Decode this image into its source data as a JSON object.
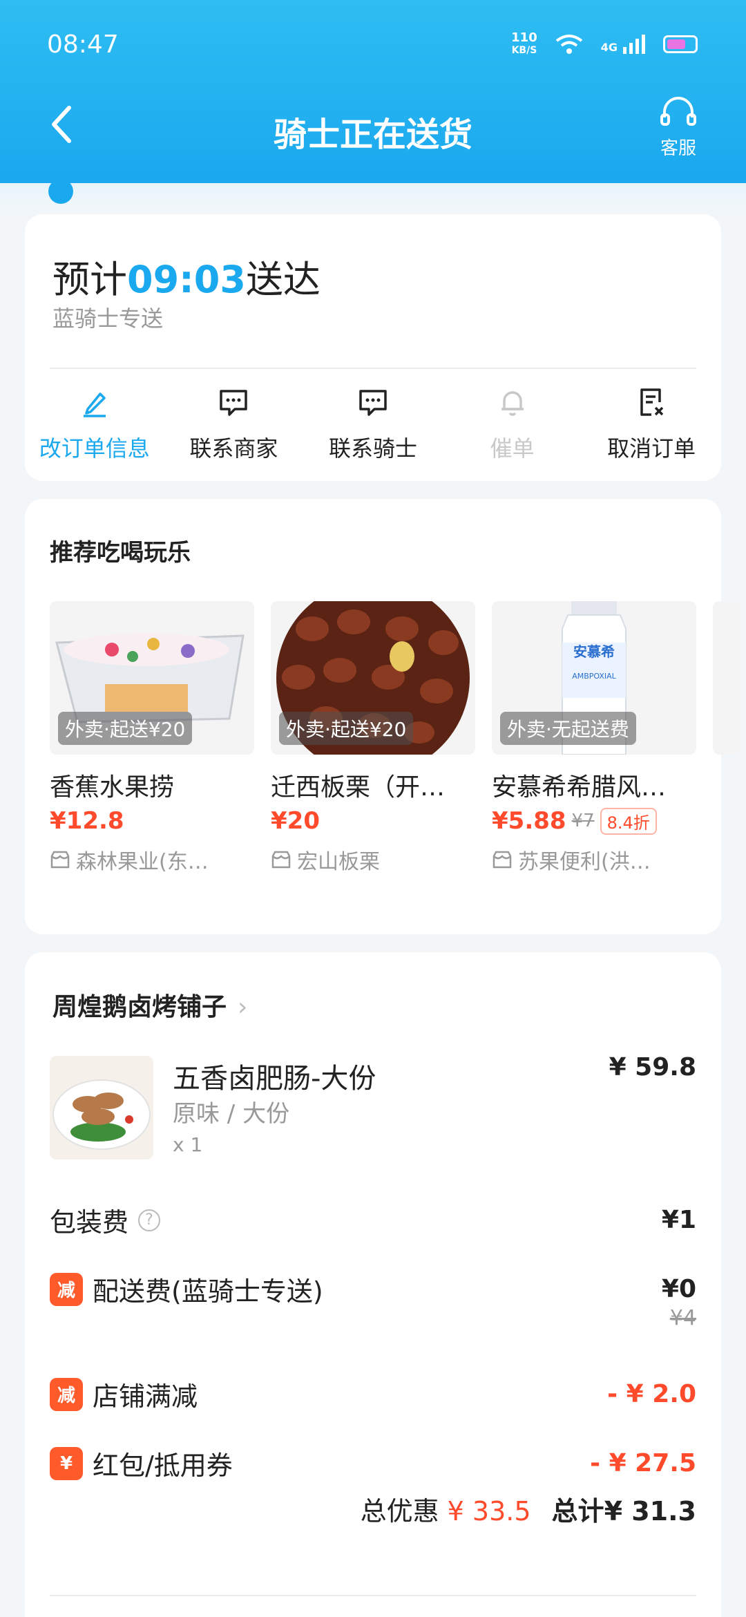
{
  "status_bar": {
    "time": "08:47",
    "speed_value": "110",
    "speed_unit": "KB/S",
    "network": "4G",
    "battery": "8"
  },
  "header": {
    "title": "骑士正在送货",
    "customer_service": "客服"
  },
  "delivery": {
    "eta_prefix": "预计",
    "eta_time": "09:03",
    "eta_suffix": "送达",
    "rider_type": "蓝骑士专送",
    "actions": [
      {
        "label": "改订单信息",
        "icon": "edit-icon",
        "state": "active"
      },
      {
        "label": "联系商家",
        "icon": "chat-icon",
        "state": "normal"
      },
      {
        "label": "联系骑士",
        "icon": "chat-icon",
        "state": "normal"
      },
      {
        "label": "催单",
        "icon": "bell-icon",
        "state": "disabled"
      },
      {
        "label": "取消订单",
        "icon": "cancel-doc-icon",
        "state": "normal"
      }
    ]
  },
  "recommend": {
    "title": "推荐吃喝玩乐",
    "items": [
      {
        "tag": "外卖·起送¥20",
        "name": "香蕉水果捞",
        "price": "¥12.8",
        "old_price": "",
        "discount": "",
        "shop": "森林果业(东…"
      },
      {
        "tag": "外卖·起送¥20",
        "name": "迁西板栗（开…",
        "price": "¥20",
        "old_price": "",
        "discount": "",
        "shop": "宏山板栗"
      },
      {
        "tag": "外卖·无起送费",
        "name": "安慕希希腊风…",
        "price": "¥5.88",
        "old_price": "¥7",
        "discount": "8.4折",
        "shop": "苏果便利(洪…"
      }
    ],
    "brand_text": "安慕希",
    "brand_sub": "AMBPOXIAL"
  },
  "order": {
    "shop_name": "周煌鹅卤烤铺子",
    "item": {
      "name": "五香卤肥肠-大份",
      "spec": "原味 / 大份",
      "qty": "x 1",
      "price": "¥ 59.8"
    },
    "packaging": {
      "label": "包装费",
      "value": "¥1"
    },
    "delivery_fee": {
      "badge": "减",
      "label": "配送费(蓝骑士专送)",
      "value": "¥0",
      "original": "¥4"
    },
    "shop_discount": {
      "badge": "减",
      "label": "店铺满减",
      "value": "- ¥ 2.0"
    },
    "coupon": {
      "badge": "¥",
      "label": "红包/抵用券",
      "value": "- ¥ 27.5"
    },
    "total_discount_label": "总优惠",
    "total_discount_value": "¥ 33.5",
    "total_label": "总计",
    "total_value": "¥ 31.3"
  },
  "colors": {
    "primary": "#1aa8ee",
    "accent_red": "#ff4a2b"
  }
}
